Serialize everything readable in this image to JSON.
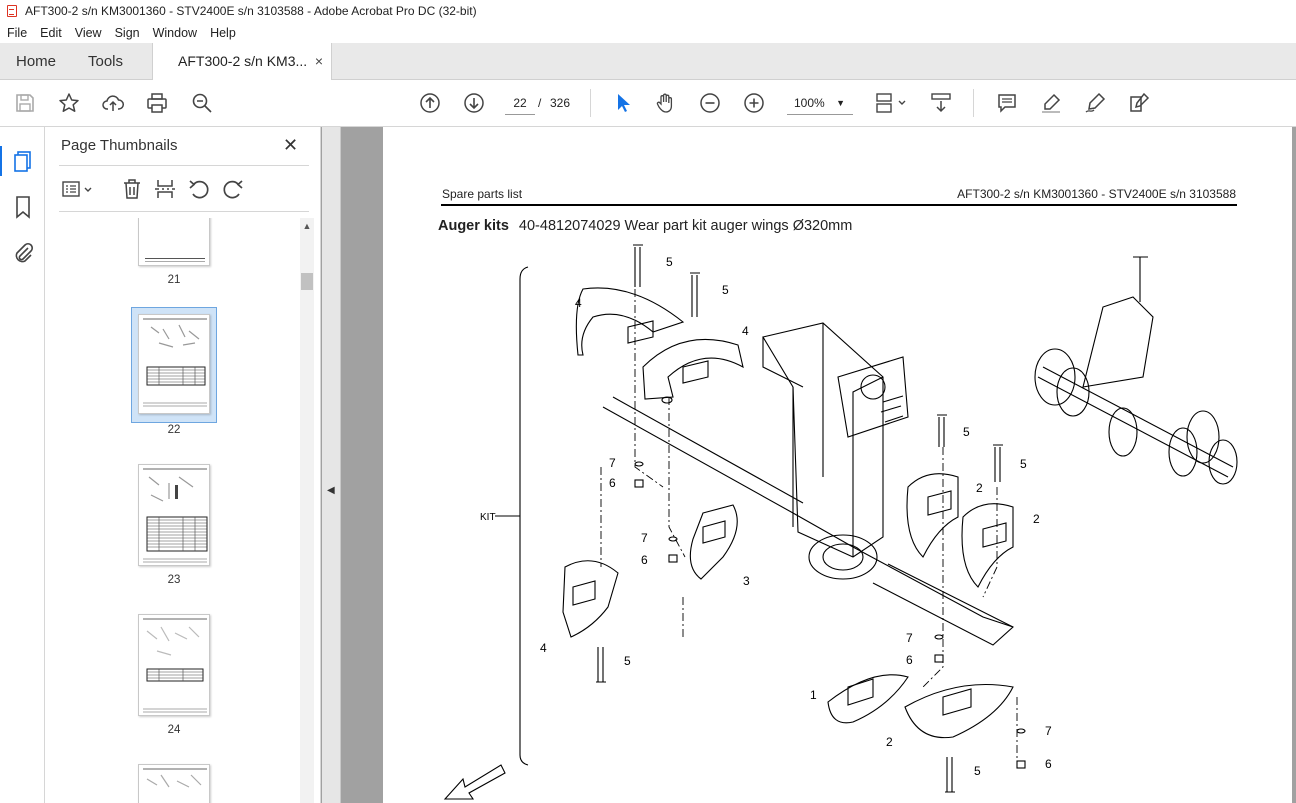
{
  "window": {
    "title": "AFT300-2 s/n KM3001360 - STV2400E s/n 3103588 - Adobe Acrobat Pro DC (32-bit)"
  },
  "menu": [
    "File",
    "Edit",
    "View",
    "Sign",
    "Window",
    "Help"
  ],
  "tabs": {
    "home": "Home",
    "tools": "Tools",
    "document": "AFT300-2 s/n KM3...",
    "close": "×"
  },
  "toolbar": {
    "current_page": "22",
    "page_separator": "/",
    "total_pages": "326",
    "zoom": "100%",
    "icons": [
      "save-icon",
      "star-icon",
      "upload-icon",
      "print-icon",
      "zoom-search-icon",
      "page-up-icon",
      "page-down-icon",
      "select-cursor-icon",
      "hand-icon",
      "zoom-out-icon",
      "zoom-in-icon",
      "page-layout-icon",
      "scroll-mode-icon",
      "comment-icon",
      "highlight-icon",
      "sign-icon",
      "fill-sign-icon"
    ]
  },
  "sidebar": {
    "title": "Page Thumbnails",
    "close": "✕",
    "thumbnails": [
      {
        "page": "21",
        "selected": false
      },
      {
        "page": "22",
        "selected": true
      },
      {
        "page": "23",
        "selected": false
      },
      {
        "page": "24",
        "selected": false
      }
    ]
  },
  "document": {
    "header_left": "Spare parts list",
    "header_right": "AFT300-2 s/n KM3001360 - STV2400E s/n 3103588",
    "heading_bold": "Auger kits",
    "heading_text": "40-4812074029 Wear part kit auger wings Ø320mm",
    "callouts": [
      "5",
      "5",
      "4",
      "4",
      "7",
      "6",
      "7",
      "6",
      "3",
      "4",
      "5",
      "5",
      "5",
      "2",
      "2",
      "7",
      "6",
      "1",
      "2",
      "7",
      "6",
      "5"
    ],
    "kit_label": "KIT"
  },
  "colors": {
    "accent": "#1473e6",
    "tab_bar": "#e9e9e9",
    "doc_background": "#a1a1a1",
    "selection": "#cfe3f7"
  }
}
